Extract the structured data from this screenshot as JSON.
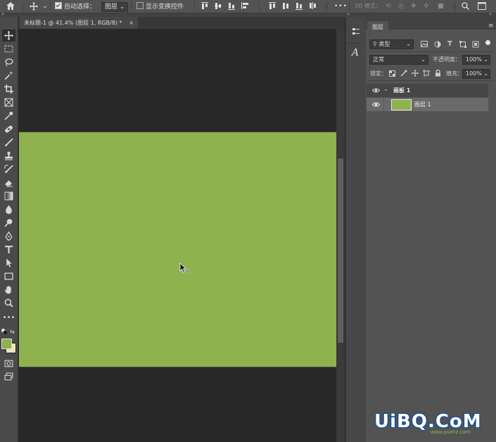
{
  "options_bar": {
    "auto_select_label": "自动选择：",
    "auto_select_target": "图层",
    "show_transform_label": "显示变换控件",
    "more_label": "•••",
    "mode_3d_label": "3D 模式："
  },
  "document": {
    "tab_title": "未标题-1 @ 41.4% (图层 1, RGB/8) *",
    "tab_close": "×"
  },
  "colors": {
    "artboard_fill": "#8db24e",
    "foreground_swatch": "#8db24e",
    "background_swatch": "#f3e7b8"
  },
  "layers_panel": {
    "tab_label": "图层",
    "filter_label": "类型",
    "blend_mode": "正常",
    "opacity_label": "不透明度：",
    "opacity_value": "100%",
    "lock_label": "锁定：",
    "fill_label": "填充：",
    "fill_value": "100%",
    "layers": [
      {
        "name": "画板 1",
        "type": "artboard"
      },
      {
        "name": "图层 1",
        "type": "layer"
      }
    ]
  },
  "watermark": {
    "main": "UiBQ.CoM",
    "sub": "www.psahz.com"
  }
}
